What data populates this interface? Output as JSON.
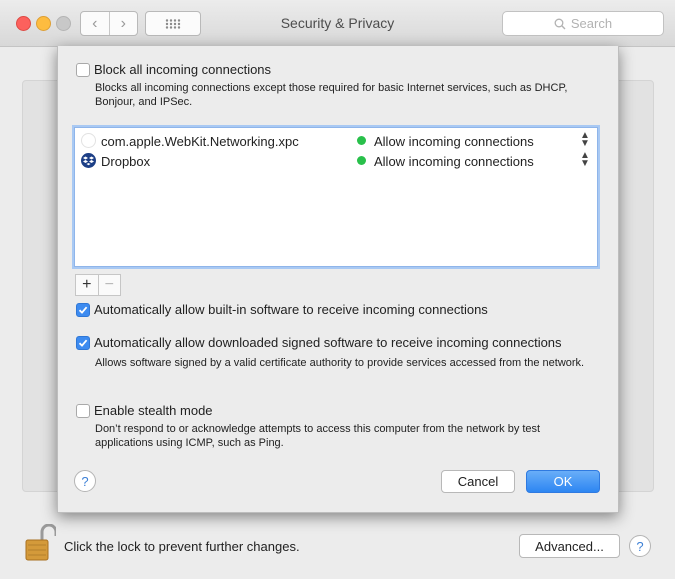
{
  "window": {
    "title": "Security & Privacy"
  },
  "toolbar": {
    "back_glyph": "‹",
    "forward_glyph": "›",
    "grid_icon": "grid-icon",
    "search_placeholder": "Search"
  },
  "firewall_options": {
    "block_all": {
      "label": "Block all incoming connections",
      "checked": false,
      "description": "Blocks all incoming connections except those required for basic Internet services, such as DHCP, Bonjour, and IPSec."
    },
    "apps": [
      {
        "name": "com.apple.WebKit.Networking.xpc",
        "icon": "webkit-app-icon",
        "status": "Allow incoming connections",
        "status_color": "#29c04b"
      },
      {
        "name": "Dropbox",
        "icon": "dropbox-app-icon",
        "status": "Allow incoming connections",
        "status_color": "#29c04b"
      }
    ],
    "add_label": "+",
    "remove_label": "−",
    "auto_builtin": {
      "label": "Automatically allow built-in software to receive incoming connections",
      "checked": true
    },
    "auto_signed": {
      "label": "Automatically allow downloaded signed software to receive incoming connections",
      "checked": true,
      "description": "Allows software signed by a valid certificate authority to provide services accessed from the network."
    },
    "stealth": {
      "label": "Enable stealth mode",
      "checked": false,
      "description": "Don’t respond to or acknowledge attempts to access this computer from the network by test applications using ICMP, such as Ping."
    },
    "help_label": "?",
    "cancel_label": "Cancel",
    "ok_label": "OK"
  },
  "footer": {
    "lock_text": "Click the lock to prevent further changes.",
    "advanced_label": "Advanced...",
    "help_label": "?"
  },
  "colors": {
    "accent": "#3d8bf0",
    "allow_green": "#29c04b"
  }
}
